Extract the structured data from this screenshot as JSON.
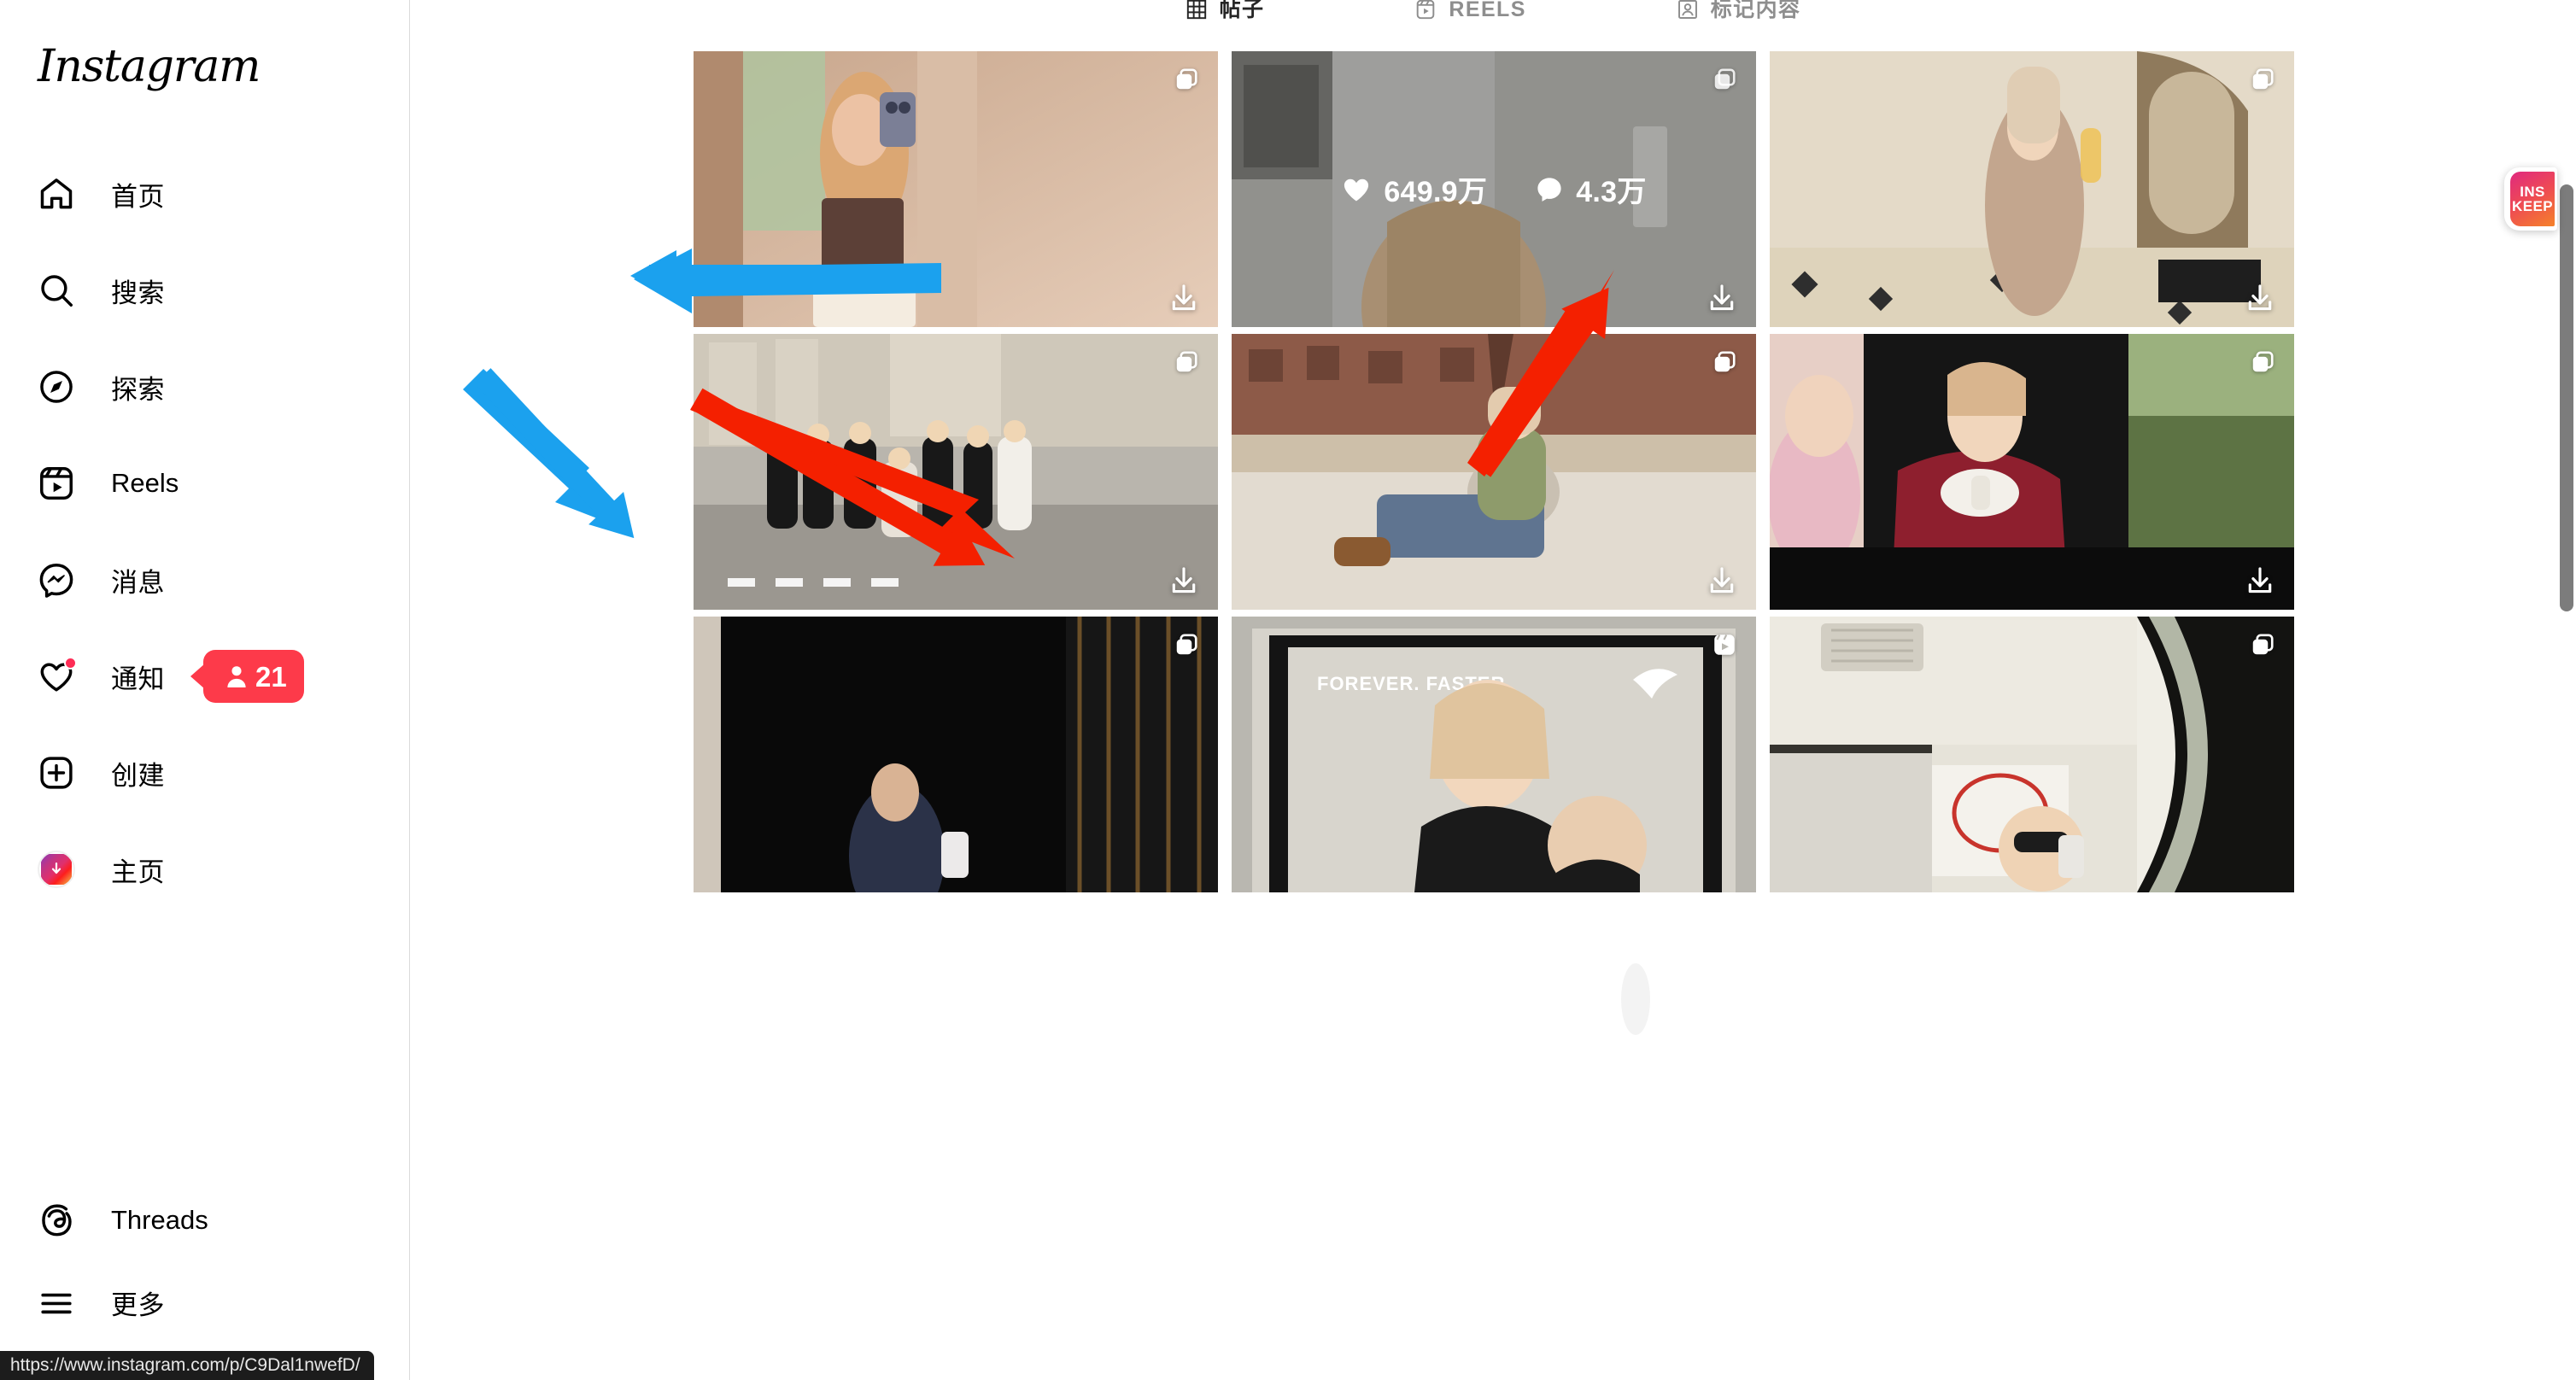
{
  "brand": {
    "name": "Instagram"
  },
  "sidebar": {
    "items": [
      {
        "key": "home",
        "label": "首页",
        "icon": "home-icon"
      },
      {
        "key": "search",
        "label": "搜索",
        "icon": "search-icon"
      },
      {
        "key": "explore",
        "label": "探索",
        "icon": "compass-icon"
      },
      {
        "key": "reels",
        "label": "Reels",
        "icon": "reels-icon"
      },
      {
        "key": "messages",
        "label": "消息",
        "icon": "messenger-icon"
      },
      {
        "key": "notifications",
        "label": "通知",
        "icon": "heart-icon",
        "badge": "21",
        "badge_icon": "person-icon",
        "has_dot": true
      },
      {
        "key": "create",
        "label": "创建",
        "icon": "plus-square-icon"
      },
      {
        "key": "profile",
        "label": "主页",
        "icon": "profile-avatar-icon"
      }
    ],
    "bottom_items": [
      {
        "key": "threads",
        "label": "Threads",
        "icon": "threads-icon"
      },
      {
        "key": "more",
        "label": "更多",
        "icon": "hamburger-icon"
      }
    ]
  },
  "status_bar": {
    "url": "https://www.instagram.com/p/C9Dal1nwefD/"
  },
  "tabs": [
    {
      "key": "posts",
      "label": "帖子",
      "icon": "grid-icon",
      "active": true
    },
    {
      "key": "reels",
      "label": "REELS",
      "icon": "reels-icon",
      "active": false
    },
    {
      "key": "tagged",
      "label": "标记内容",
      "icon": "tagged-icon",
      "active": false
    }
  ],
  "grid": {
    "download_icon": "download-icon",
    "cells": [
      {
        "id": "c1",
        "type": "carousel",
        "type_icon": "carousel-icon",
        "download": true,
        "hovered": false
      },
      {
        "id": "c2",
        "type": "carousel",
        "type_icon": "carousel-icon",
        "download": true,
        "hovered": true,
        "stats": {
          "likes_icon": "heart-filled-icon",
          "likes": "649.9万",
          "comments_icon": "comment-filled-icon",
          "comments": "4.3万"
        }
      },
      {
        "id": "c3",
        "type": "carousel",
        "type_icon": "carousel-icon",
        "download": true,
        "hovered": false
      },
      {
        "id": "c4",
        "type": "carousel",
        "type_icon": "carousel-icon",
        "download": true,
        "hovered": false
      },
      {
        "id": "c5",
        "type": "carousel",
        "type_icon": "carousel-icon",
        "download": true,
        "hovered": false
      },
      {
        "id": "c6",
        "type": "carousel",
        "type_icon": "carousel-icon",
        "download": true,
        "hovered": false
      },
      {
        "id": "c7",
        "type": "carousel",
        "type_icon": "carousel-icon",
        "download": false,
        "hovered": false
      },
      {
        "id": "c8",
        "type": "reel",
        "type_icon": "reels-icon",
        "download": false,
        "hovered": false
      },
      {
        "id": "c9",
        "type": "carousel",
        "type_icon": "carousel-icon",
        "download": false,
        "hovered": false
      }
    ]
  },
  "annotations": {
    "arrows": [
      {
        "id": "a1",
        "color": "#1BA1EE",
        "label": "blue-arrow-to-download-row1"
      },
      {
        "id": "a2",
        "color": "#1BA1EE",
        "label": "blue-arrow-to-download-row2"
      },
      {
        "id": "a3",
        "color": "#F42000",
        "label": "red-arrow-to-download-row2-mid"
      },
      {
        "id": "a4",
        "color": "#F42000",
        "label": "red-arrow-to-download-row1-right"
      }
    ],
    "colors": {
      "blue": "#1BA1EE",
      "red": "#F42000"
    }
  },
  "extension_badge": {
    "line1": "INS",
    "line2": "KEEP",
    "gradient_from": "#e0297f",
    "gradient_to": "#f58229"
  },
  "theme": {
    "background": "#ffffff",
    "border": "#dbdbdb",
    "text_primary": "#262626",
    "text_muted": "#8e8e8e",
    "badge_red": "#FD3A4A",
    "scrollbar": "#7c7c7c"
  }
}
